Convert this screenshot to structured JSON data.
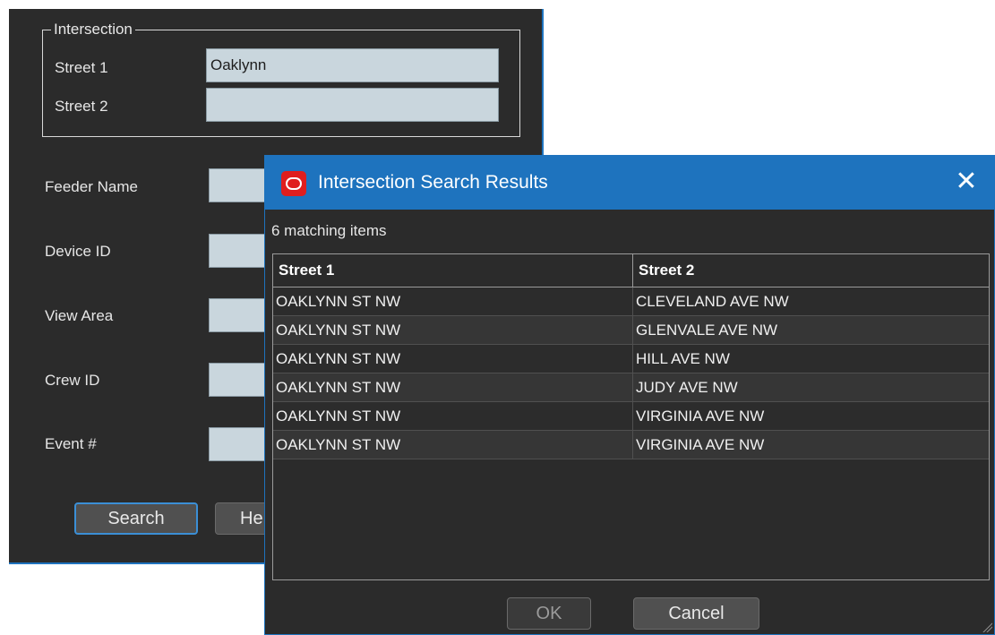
{
  "search_panel": {
    "intersection_legend": "Intersection",
    "street1_label": "Street 1",
    "street1_value": "Oaklynn",
    "street2_label": "Street 2",
    "street2_value": "",
    "feeder_name_label": "Feeder Name",
    "device_id_label": "Device ID",
    "view_area_label": "View Area",
    "crew_id_label": "Crew ID",
    "event_label": "Event #",
    "search_button": "Search",
    "help_button_partial": "He"
  },
  "dialog": {
    "title": "Intersection Search Results",
    "logo_icon": "oracle-logo-icon",
    "close_icon": "close-icon",
    "count_text": "6 matching items",
    "columns": [
      "Street 1",
      "Street 2"
    ],
    "rows": [
      {
        "street1": "OAKLYNN ST NW",
        "street2": "CLEVELAND AVE NW"
      },
      {
        "street1": "OAKLYNN ST NW",
        "street2": "GLENVALE AVE NW"
      },
      {
        "street1": "OAKLYNN ST NW",
        "street2": "HILL AVE NW"
      },
      {
        "street1": "OAKLYNN ST NW",
        "street2": "JUDY AVE NW"
      },
      {
        "street1": "OAKLYNN ST NW",
        "street2": "VIRGINIA AVE NW"
      },
      {
        "street1": "OAKLYNN ST NW",
        "street2": "VIRGINIA AVE NW"
      }
    ],
    "ok_button": "OK",
    "cancel_button": "Cancel"
  },
  "colors": {
    "title_bar": "#1e73be",
    "panel_bg": "#2b2b2b",
    "input_bg": "#c9d6dd",
    "logo_red": "#e01e1e"
  }
}
